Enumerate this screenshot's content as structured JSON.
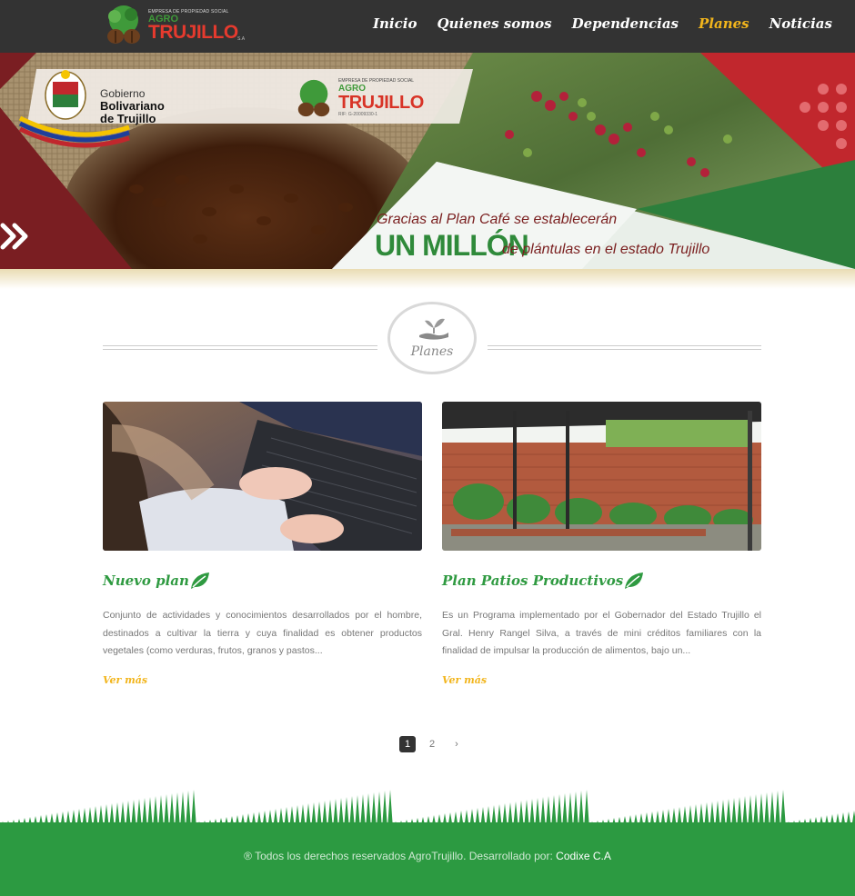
{
  "header": {
    "logo": {
      "small": "EMPRESA DE PROPIEDAD SOCIAL",
      "agro": "AGRO",
      "name": "TRUJILLO",
      "suffix": "S.A"
    },
    "nav": [
      {
        "label": "Inicio",
        "active": false
      },
      {
        "label": "Quienes somos",
        "active": false
      },
      {
        "label": "Dependencias",
        "active": false
      },
      {
        "label": "Planes",
        "active": true
      },
      {
        "label": "Noticias",
        "active": false
      }
    ]
  },
  "banner": {
    "gov_line1": "Gobierno",
    "gov_line2": "Bolivariano",
    "gov_line3": "de Trujillo",
    "logo_small": "EMPRESA DE PROPIEDAD SOCIAL",
    "logo_agro": "AGRO",
    "logo_name": "TRUJILLO",
    "logo_rif": "RIF: G-20009330-1",
    "tagline_1": "Gracias al Plan Café se establecerán",
    "tagline_2": "UN MILLÓN",
    "tagline_3": "de plántulas en el estado Trujillo"
  },
  "section": {
    "title": "Planes"
  },
  "cards": [
    {
      "title": "Nuevo plan",
      "description": "Conjunto de actividades y conocimientos desarrollados por el hombre, destinados a cultivar la tierra y cuya finalidad es obtener productos vegetales (como verduras, frutos, granos y pastos...",
      "more": "Ver más"
    },
    {
      "title": "Plan Patios Productivos",
      "description": "Es un Programa implementado por el Gobernador del Estado Trujillo el Gral. Henry Rangel Silva, a través de mini créditos familiares con la finalidad de impulsar la producción de alimentos, bajo un...",
      "more": "Ver más"
    }
  ],
  "pagination": {
    "pages": [
      "1",
      "2"
    ],
    "current": "1",
    "next": "›"
  },
  "footer": {
    "text": "® Todos los derechos reservados AgroTrujillo. Desarrollado por:",
    "developer": "Codixe C.A"
  },
  "colors": {
    "header_bg": "#333333",
    "accent": "#f2b51c",
    "green": "#2c9a41",
    "red": "#c1272d"
  }
}
